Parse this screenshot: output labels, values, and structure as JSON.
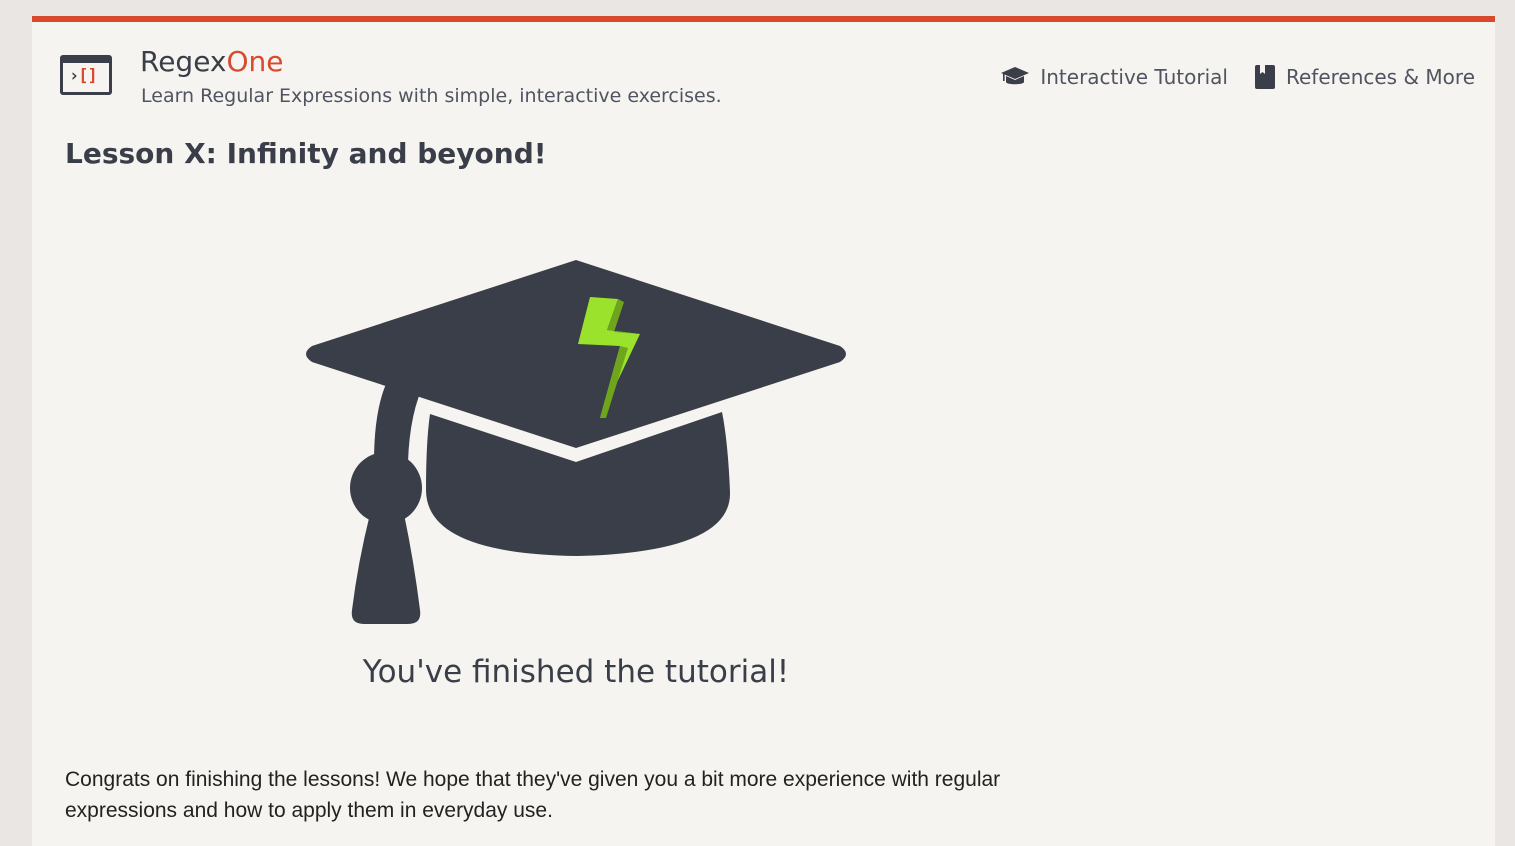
{
  "header": {
    "brand_prefix": "Regex",
    "brand_suffix": "One",
    "tagline": "Learn Regular Expressions with simple, interactive exercises.",
    "logo_icon": "terminal-brackets-icon"
  },
  "nav": {
    "items": [
      {
        "label": "Interactive Tutorial",
        "icon": "graduation-cap-icon"
      },
      {
        "label": "References & More",
        "icon": "book-icon"
      }
    ]
  },
  "lesson": {
    "title": "Lesson X: Infinity and beyond!",
    "illustration": "graduation-cap-lightning-icon",
    "finish_text": "You've finished the tutorial!",
    "congrats": "Congrats on finishing the lessons! We hope that they've given you a bit more experience with regular expressions and how to apply them in everyday use."
  },
  "colors": {
    "accent": "#d9492e",
    "dark": "#3a3e48",
    "lightning": "#9be22d",
    "background": "#f5f4f0"
  }
}
